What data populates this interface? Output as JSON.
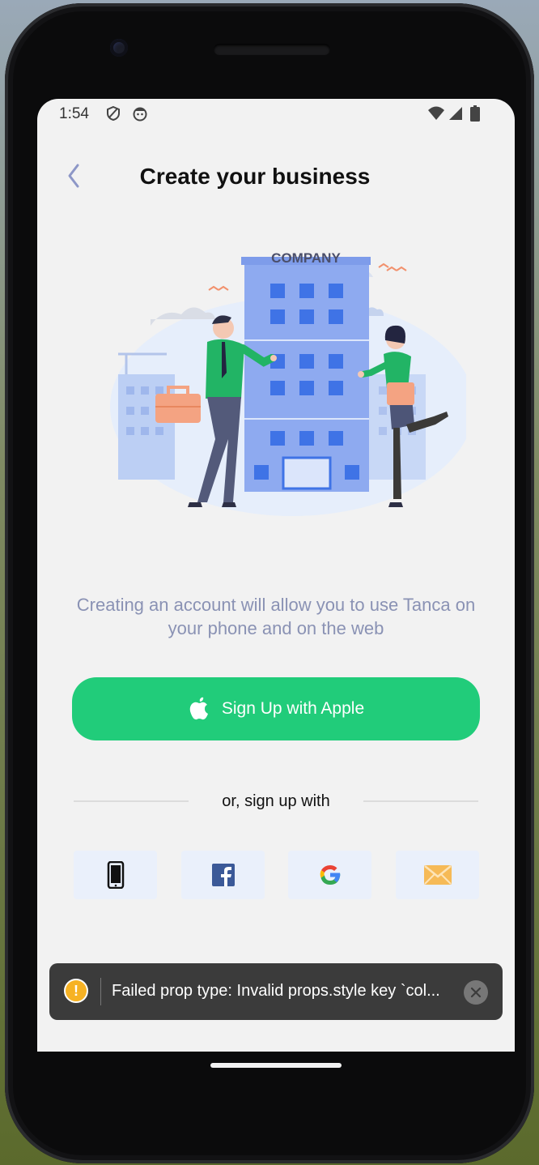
{
  "status_bar": {
    "time": "1:54"
  },
  "header": {
    "title": "Create your business"
  },
  "illustration": {
    "sign": "COMPANY"
  },
  "description": "Creating an account will allow you to use Tanca on your phone and on the web",
  "apple_button": {
    "label": "Sign Up with Apple"
  },
  "divider_text": "or, sign up with",
  "social_options": [
    "phone-icon",
    "facebook-icon",
    "google-icon",
    "email-icon"
  ],
  "toast": {
    "message": "Failed prop type: Invalid props.style key `col..."
  },
  "colors": {
    "accent_green": "#21cc7a",
    "text_muted": "#8a92b4",
    "background": "#f2f2f2"
  }
}
